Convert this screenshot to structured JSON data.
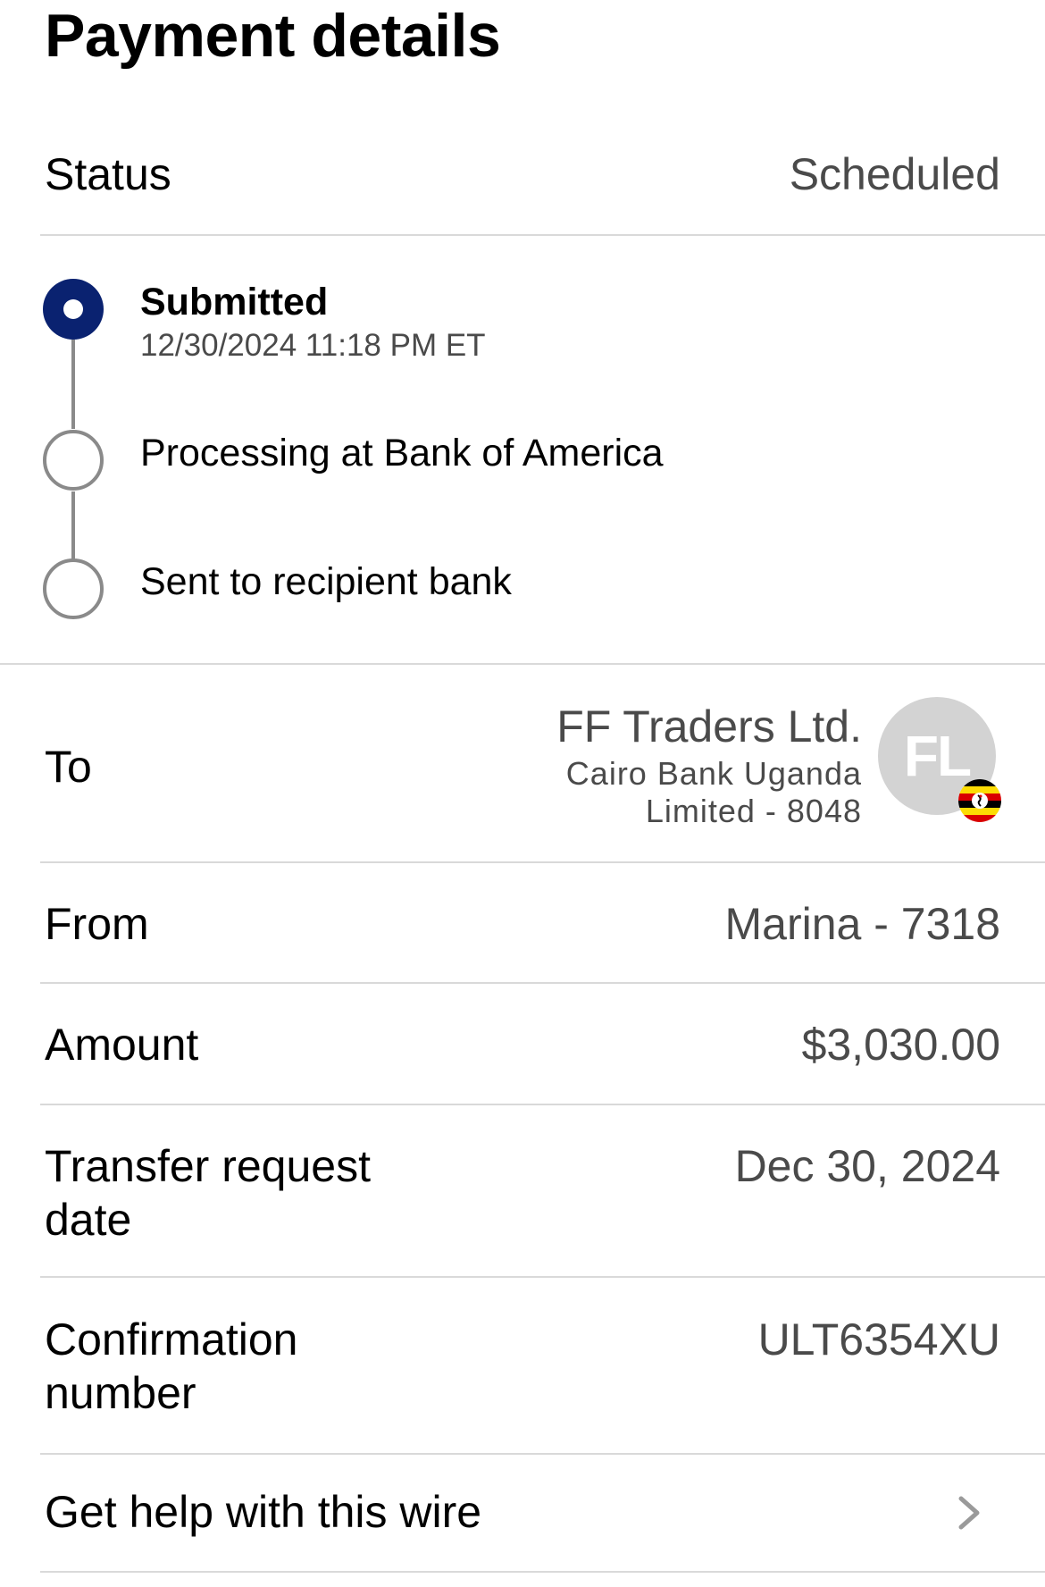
{
  "page": {
    "title": "Payment details"
  },
  "status": {
    "label": "Status",
    "value": "Scheduled"
  },
  "timeline": {
    "steps": [
      {
        "title": "Submitted",
        "subtitle": "12/30/2024 11:18 PM ET",
        "state": "completed"
      },
      {
        "title": "Processing at Bank of America",
        "state": "pending"
      },
      {
        "title": "Sent to recipient bank",
        "state": "pending"
      }
    ]
  },
  "recipient": {
    "label": "To",
    "name": "FF Traders Ltd.",
    "bank_line1": "Cairo Bank Uganda",
    "bank_line2": "Limited - 8048",
    "avatar_initials": "FL",
    "flag_icon": "uganda-flag-icon"
  },
  "from": {
    "label": "From",
    "value": "Marina - 7318"
  },
  "amount": {
    "label": "Amount",
    "value": "$3,030.00"
  },
  "transfer_date": {
    "label_line1": "Transfer request",
    "label_line2": "date",
    "value": "Dec 30, 2024"
  },
  "confirmation": {
    "label_line1": "Confirmation",
    "label_line2": "number",
    "value": "ULT6354XU"
  },
  "help": {
    "label": "Get help with this wire",
    "icon": "chevron-right-icon"
  },
  "colors": {
    "accent": "#0a2270",
    "muted_text": "#4a4a4a",
    "divider": "#d9d9d9",
    "timeline_gray": "#8a8a8a"
  }
}
